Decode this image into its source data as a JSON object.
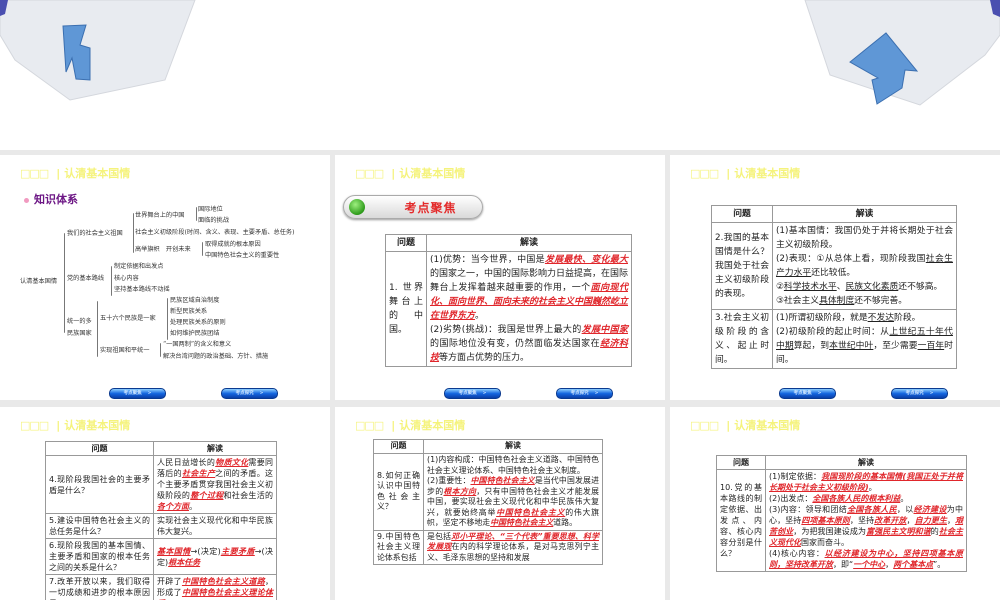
{
  "section_header": {
    "boxes": "□□□",
    "separator": "|",
    "title": "认清基本国情"
  },
  "colors": {
    "header": "#f5f37c",
    "highlight": "#e0262b",
    "accent_title": "#6d1785"
  },
  "nav_buttons": {
    "prev": "考点聚焦",
    "next": "考点探究",
    "chevron": ">"
  },
  "slide1": {
    "title": "知识体系",
    "mindmap": [
      "认清基本国情",
      "我们的社会主义祖国",
      "世界舞台上的中国",
      "国际地位",
      "面临的挑战",
      "社会主义初级阶段(时间、含义、表现、主要矛盾、总任务)",
      "高举旗帜　开创未来",
      "取得成就的根本原因",
      "中国特色社会主义的重要性",
      "党的基本路线",
      "制定依据和出发点",
      "核心内容",
      "坚持基本路线不动摇",
      "统一的多",
      "民族国家",
      "五十六个民族是一家",
      "民族区域自治制度",
      "新型民族关系",
      "处理民族关系的原则",
      "如何维护民族团结",
      "实现祖国和平统一",
      "“一国两制”的含义和意义",
      "解决台湾问题的政治基础、方针、措施"
    ]
  },
  "slide2": {
    "banner": "考点聚焦",
    "headers": [
      "问题",
      "解读"
    ],
    "rows": [
      {
        "q": "1. 世界舞台上的中国。",
        "a": [
          [
            {
              "t": "(1)优势：当今世界，中国是"
            },
            {
              "t": "发展最快、变化最大",
              "s": "r"
            },
            {
              "t": "的国家之一，中国的国际影响力日益提高，在国际舞台上发挥着越来越重要的作用，一个"
            },
            {
              "t": "面向现代化、面向世界、面向未来的社会主义中国巍然屹立在世界东方",
              "s": "r"
            },
            {
              "t": "。"
            }
          ],
          [
            {
              "t": "(2)劣势(挑战)：我国是世界上最大的"
            },
            {
              "t": "发展中国家",
              "s": "r"
            },
            {
              "t": "的国际地位没有变，仍然面临发达国家在"
            },
            {
              "t": "经济科技",
              "s": "r"
            },
            {
              "t": "等方面占优势的压力。"
            }
          ]
        ]
      }
    ]
  },
  "slide3": {
    "headers": [
      "问题",
      "解读"
    ],
    "rows": [
      {
        "q": "2.我国的基本国情是什么？我国处于社会主义初级阶段的表现。",
        "a": [
          [
            {
              "t": "(1)基本国情：我国仍处于并将长期处于社会主义初级阶段。"
            }
          ],
          [
            {
              "t": "(2)表现：①从总体上看，现阶段我国"
            },
            {
              "t": "社会生产力水平",
              "s": "u"
            },
            {
              "t": "还比较低。"
            }
          ],
          [
            {
              "t": "②"
            },
            {
              "t": "科学技术水平",
              "s": "u"
            },
            {
              "t": "、"
            },
            {
              "t": "民族文化素质",
              "s": "u"
            },
            {
              "t": "还不够高。"
            }
          ],
          [
            {
              "t": "③社会主义"
            },
            {
              "t": "具体制度",
              "s": "u"
            },
            {
              "t": "还不够完善。"
            }
          ]
        ]
      },
      {
        "q": "3.社会主义初级阶段的含义、起止时间。",
        "a": [
          [
            {
              "t": "(1)所谓初级阶段，就是"
            },
            {
              "t": "不发达",
              "s": "u"
            },
            {
              "t": "阶段。"
            }
          ],
          [
            {
              "t": "(2)初级阶段的起止时间：从"
            },
            {
              "t": "上世纪五十年代中期",
              "s": "u"
            },
            {
              "t": "算起，到"
            },
            {
              "t": "本世纪中叶",
              "s": "u"
            },
            {
              "t": "，至少需要"
            },
            {
              "t": "一百年",
              "s": "u"
            },
            {
              "t": "时间。"
            }
          ]
        ]
      }
    ]
  },
  "slide4": {
    "headers": [
      "问题",
      "解读"
    ],
    "rows": [
      {
        "q": "4.现阶段我国社会的主要矛盾是什么？",
        "a": [
          [
            {
              "t": "人民日益增长的"
            },
            {
              "t": "物质文化",
              "s": "r"
            },
            {
              "t": "需要同落后的"
            },
            {
              "t": "社会生产",
              "s": "r"
            },
            {
              "t": "之间的矛盾。这个主要矛盾贯穿我国社会主义初级阶段的"
            },
            {
              "t": "整个过程",
              "s": "r"
            },
            {
              "t": "和社会生活的"
            },
            {
              "t": "各个方面",
              "s": "r"
            },
            {
              "t": "。"
            }
          ]
        ]
      },
      {
        "q": "5.建设中国特色社会主义的总任务是什么？",
        "a": [
          [
            {
              "t": "实现社会主义现代化和中华民族伟大复兴。"
            }
          ]
        ]
      },
      {
        "q": "6.现阶段我国的基本国情、主要矛盾和国家的根本任务之间的关系是什么？",
        "a": [
          [
            {
              "t": "基本国情",
              "s": "r"
            },
            {
              "t": "→(决定)"
            },
            {
              "t": "主要矛盾",
              "s": "r"
            },
            {
              "t": "→(决定)"
            },
            {
              "t": "根本任务",
              "s": "r"
            }
          ]
        ]
      },
      {
        "q": "7.改革开放以来，我们取得一切成绩和进步的根本原因是",
        "a": [
          [
            {
              "t": "开辟了"
            },
            {
              "t": "中国特色社会主义道路",
              "s": "r"
            },
            {
              "t": "，形成了"
            },
            {
              "t": "中国特色社会主义理论体系",
              "s": "r"
            }
          ]
        ]
      }
    ]
  },
  "slide5": {
    "headers": [
      "问题",
      "解读"
    ],
    "rows": [
      {
        "q": "8.如何正确认识中国特色社会主义？",
        "a": [
          [
            {
              "t": "(1)内容构成：中国特色社会主义道路、中国特色社会主义理论体系、中国特色社会主义制度。"
            }
          ],
          [
            {
              "t": "(2)重要性："
            },
            {
              "t": "中国特色社会主义",
              "s": "r"
            },
            {
              "t": "是当代中国发展进步的"
            },
            {
              "t": "根本方向",
              "s": "r"
            },
            {
              "t": "，只有中国特色社会主义才能发展中国，要实现社会主义现代化和中华民族伟大复兴，就要始终高举"
            },
            {
              "t": "中国特色社会主义",
              "s": "r"
            },
            {
              "t": "的伟大旗帜，坚定不移地走"
            },
            {
              "t": "中国特色社会主义",
              "s": "r"
            },
            {
              "t": "道路。"
            }
          ]
        ]
      },
      {
        "q": "9.中国特色社会主义理论体系包括",
        "a": [
          [
            {
              "t": "是包括"
            },
            {
              "t": "邓小平理论、“三个代表”重要思想、科学发展观",
              "s": "r"
            },
            {
              "t": "在内的科学理论体系，是对马克思列宁主义、毛泽东思想的坚持和发展"
            }
          ]
        ]
      }
    ]
  },
  "slide6": {
    "headers": [
      "问题",
      "解读"
    ],
    "rows": [
      {
        "q": "10.党的基本路线的制定依据、出发点、内容、核心内容分别是什么？",
        "a": [
          [
            {
              "t": "(1)制定依据："
            },
            {
              "t": "我国现阶段的基本国情(我国正处于并将长期处于社会主义初级阶段)",
              "s": "r"
            },
            {
              "t": "。"
            }
          ],
          [
            {
              "t": "(2)出发点："
            },
            {
              "t": "全国各族人民的根本利益",
              "s": "r"
            },
            {
              "t": "。"
            }
          ],
          [
            {
              "t": "(3)内容：领导和团结"
            },
            {
              "t": "全国各族人民",
              "s": "r"
            },
            {
              "t": "，以"
            },
            {
              "t": "经济建设",
              "s": "r"
            },
            {
              "t": "为中心，坚持"
            },
            {
              "t": "四项基本原则",
              "s": "r"
            },
            {
              "t": "，坚持"
            },
            {
              "t": "改革开放",
              "s": "r"
            },
            {
              "t": "，"
            },
            {
              "t": "自力更生",
              "s": "r"
            },
            {
              "t": "，"
            },
            {
              "t": "艰苦创业",
              "s": "r"
            },
            {
              "t": "，为把我国建设成为"
            },
            {
              "t": "富强民主文明和谐",
              "s": "r"
            },
            {
              "t": "的"
            },
            {
              "t": "社会主义现代化",
              "s": "r"
            },
            {
              "t": "国家而奋斗。"
            }
          ],
          [
            {
              "t": "(4)核心内容："
            },
            {
              "t": "以经济建设为中心，坚持四项基本原则，坚持改革开放",
              "s": "r"
            },
            {
              "t": "，即“"
            },
            {
              "t": "一个中心",
              "s": "r"
            },
            {
              "t": "，"
            },
            {
              "t": "两个基本点",
              "s": "r"
            },
            {
              "t": "”。"
            }
          ]
        ]
      }
    ]
  }
}
